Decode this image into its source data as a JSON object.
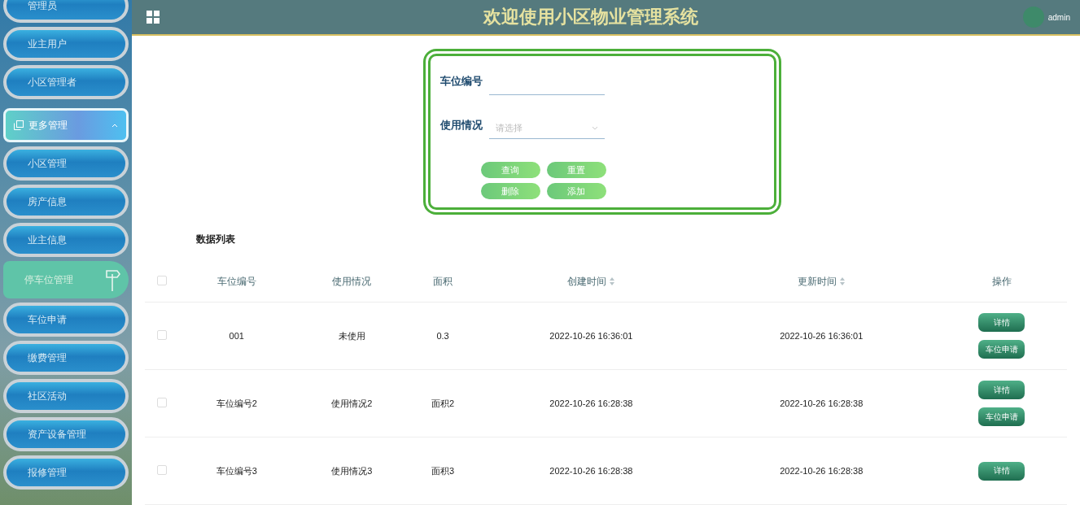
{
  "header": {
    "title": "欢迎使用小区物业管理系统",
    "user": "admin"
  },
  "sidebar": {
    "items": [
      {
        "label": "管理员",
        "kind": "item",
        "selected": false
      },
      {
        "label": "业主用户",
        "kind": "item",
        "selected": false
      },
      {
        "label": "小区管理者",
        "kind": "item",
        "selected": false
      },
      {
        "label": "更多管理",
        "kind": "group",
        "expanded": true,
        "children": [
          {
            "label": "小区管理",
            "selected": false
          },
          {
            "label": "房产信息",
            "selected": false
          },
          {
            "label": "业主信息",
            "selected": false
          },
          {
            "label": "停车位管理",
            "selected": true
          },
          {
            "label": "车位申请",
            "selected": false
          },
          {
            "label": "缴费管理",
            "selected": false
          },
          {
            "label": "社区活动",
            "selected": false
          },
          {
            "label": "资产设备管理",
            "selected": false
          },
          {
            "label": "报修管理",
            "selected": false
          }
        ]
      }
    ]
  },
  "search": {
    "fields": [
      {
        "label": "车位编号",
        "kind": "text"
      },
      {
        "label": "使用情况",
        "kind": "select",
        "placeholder": "请选择"
      }
    ],
    "buttons": [
      "查询",
      "重置",
      "删除",
      "添加"
    ]
  },
  "table": {
    "title": "数据列表",
    "all_checked": false,
    "columns": [
      {
        "label": "车位编号",
        "sortable": false
      },
      {
        "label": "使用情况",
        "sortable": false
      },
      {
        "label": "面积",
        "sortable": false
      },
      {
        "label": "创建时间",
        "sortable": true
      },
      {
        "label": "更新时间",
        "sortable": true
      },
      {
        "label": "操作",
        "sortable": false
      }
    ],
    "rows": [
      {
        "checked": false,
        "cells": [
          "001",
          "未使用",
          "0.3",
          "2022-10-26 16:36:01",
          "2022-10-26 16:36:01"
        ],
        "actions": [
          "详情",
          "车位申请"
        ]
      },
      {
        "checked": false,
        "cells": [
          "车位编号2",
          "使用情况2",
          "面积2",
          "2022-10-26 16:28:38",
          "2022-10-26 16:28:38"
        ],
        "actions": [
          "详情",
          "车位申请"
        ]
      },
      {
        "checked": false,
        "cells": [
          "车位编号3",
          "使用情况3",
          "面积3",
          "2022-10-26 16:28:38",
          "2022-10-26 16:28:38"
        ],
        "actions": [
          "详情"
        ]
      }
    ]
  }
}
